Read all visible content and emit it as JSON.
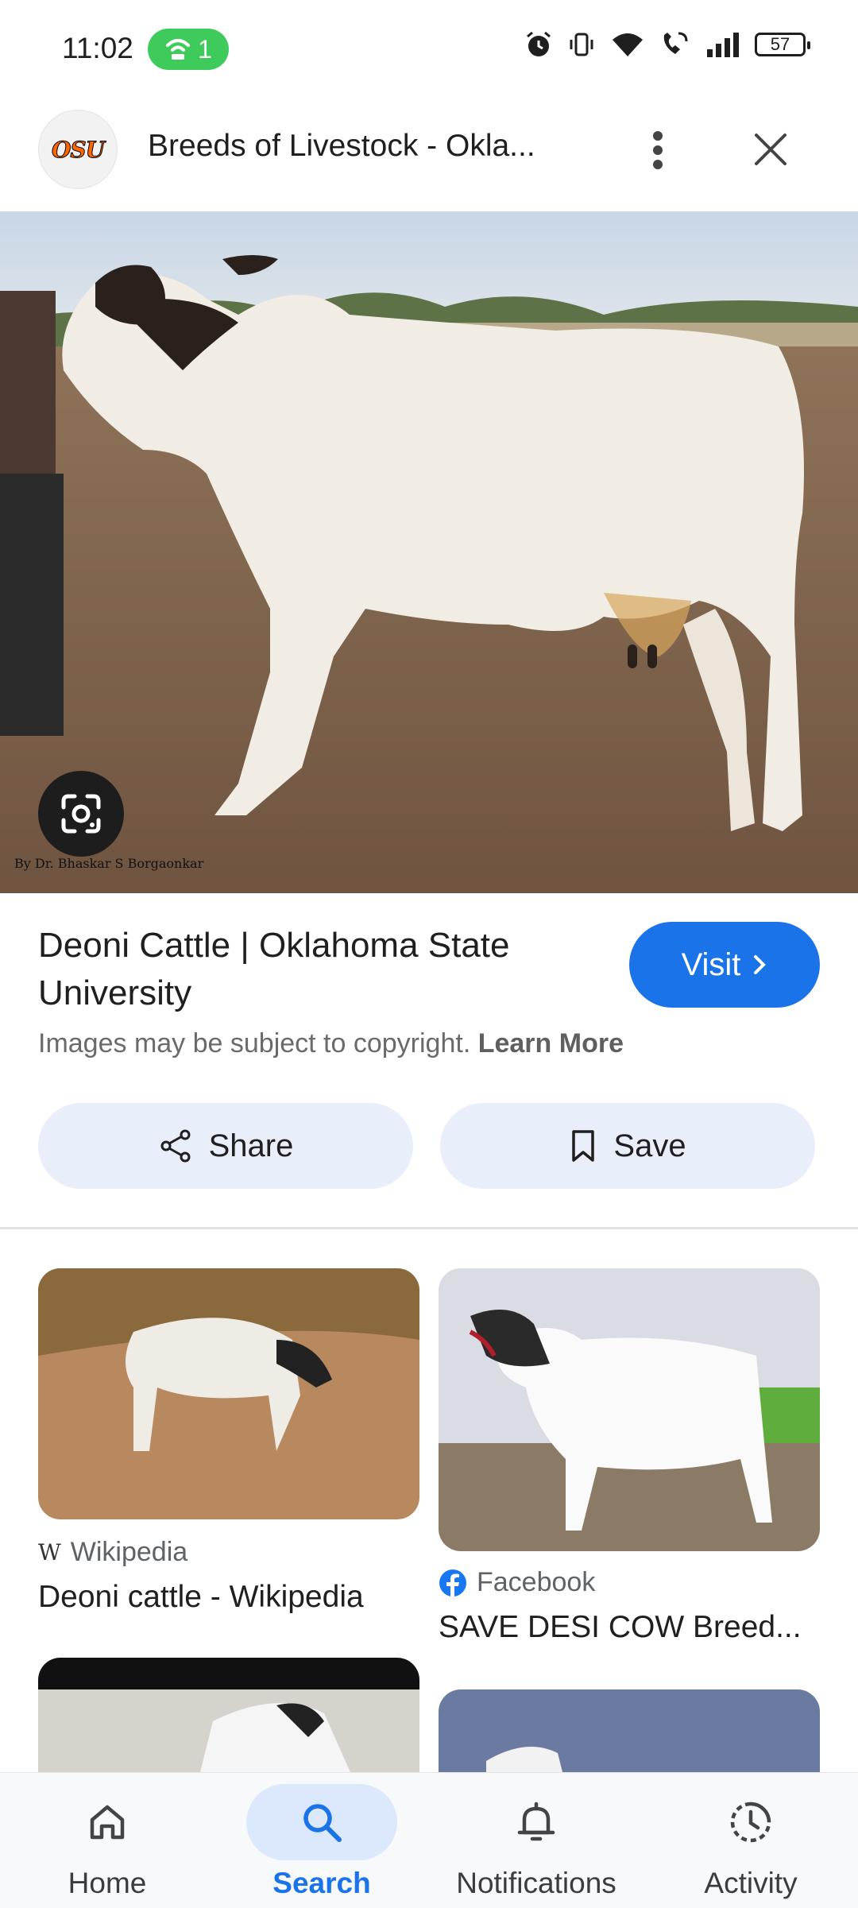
{
  "status_bar": {
    "time": "11:02",
    "hotspot_count": "1",
    "battery": "57"
  },
  "header": {
    "title": "Breeds of Livestock - Okla...",
    "site_logo_text": "OSU"
  },
  "hero": {
    "watermark": "By Dr. Bhaskar S Borgaonkar"
  },
  "result": {
    "title": "Deoni Cattle | Oklahoma State University",
    "visit_label": "Visit",
    "copyright_text": "Images may be subject to copyright.",
    "learn_more": "Learn More",
    "share_label": "Share",
    "save_label": "Save"
  },
  "related": [
    {
      "source": "Wikipedia",
      "title": "Deoni cattle - Wikipedia"
    },
    {
      "source": "Facebook",
      "title": "SAVE DESI COW Breed..."
    }
  ],
  "bottom_nav": [
    {
      "label": "Home",
      "icon": "home-icon"
    },
    {
      "label": "Search",
      "icon": "search-icon",
      "active": true
    },
    {
      "label": "Notifications",
      "icon": "bell-icon"
    },
    {
      "label": "Activity",
      "icon": "activity-icon"
    }
  ],
  "colors": {
    "accent": "#1a73e8",
    "pill_bg": "#e8effb",
    "hotspot": "#3fcb5b"
  }
}
